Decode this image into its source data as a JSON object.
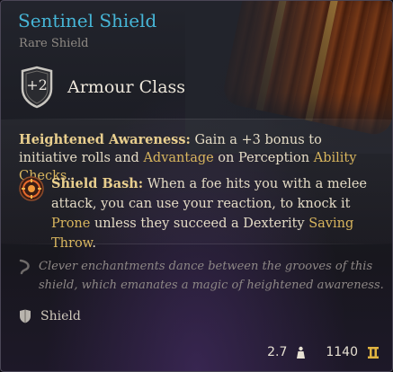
{
  "item": {
    "name": "Sentinel Shield",
    "rarity": "Rare Shield",
    "name_color": "#46b5d6"
  },
  "armour": {
    "value": "+2",
    "label": "Armour Class"
  },
  "passives": {
    "heightened": {
      "title": "Heightened Awareness:",
      "text1": " Gain a +3 bonus to initiative rolls and ",
      "link1": "Advantage",
      "text2": " on Perception ",
      "link2": "Ability Checks",
      "text3": "."
    },
    "bash": {
      "icon": "shield-bash-icon",
      "title": "Shield Bash:",
      "text1": " When a foe hits you with a melee attack, you can use your reaction, to knock it ",
      "link1": "Prone",
      "text2": " unless they succeed a Dexterity ",
      "link2": "Saving Throw",
      "text3": "."
    }
  },
  "flavor": {
    "icon": "quill-icon",
    "text": "Clever enchantments dance between the grooves of this shield, which emanates a magic of heightened awareness."
  },
  "type": {
    "icon": "shield-icon",
    "label": "Shield"
  },
  "footer": {
    "weight": "2.7",
    "weight_icon": "weight-icon",
    "value": "1140",
    "value_icon": "gold-icon"
  }
}
